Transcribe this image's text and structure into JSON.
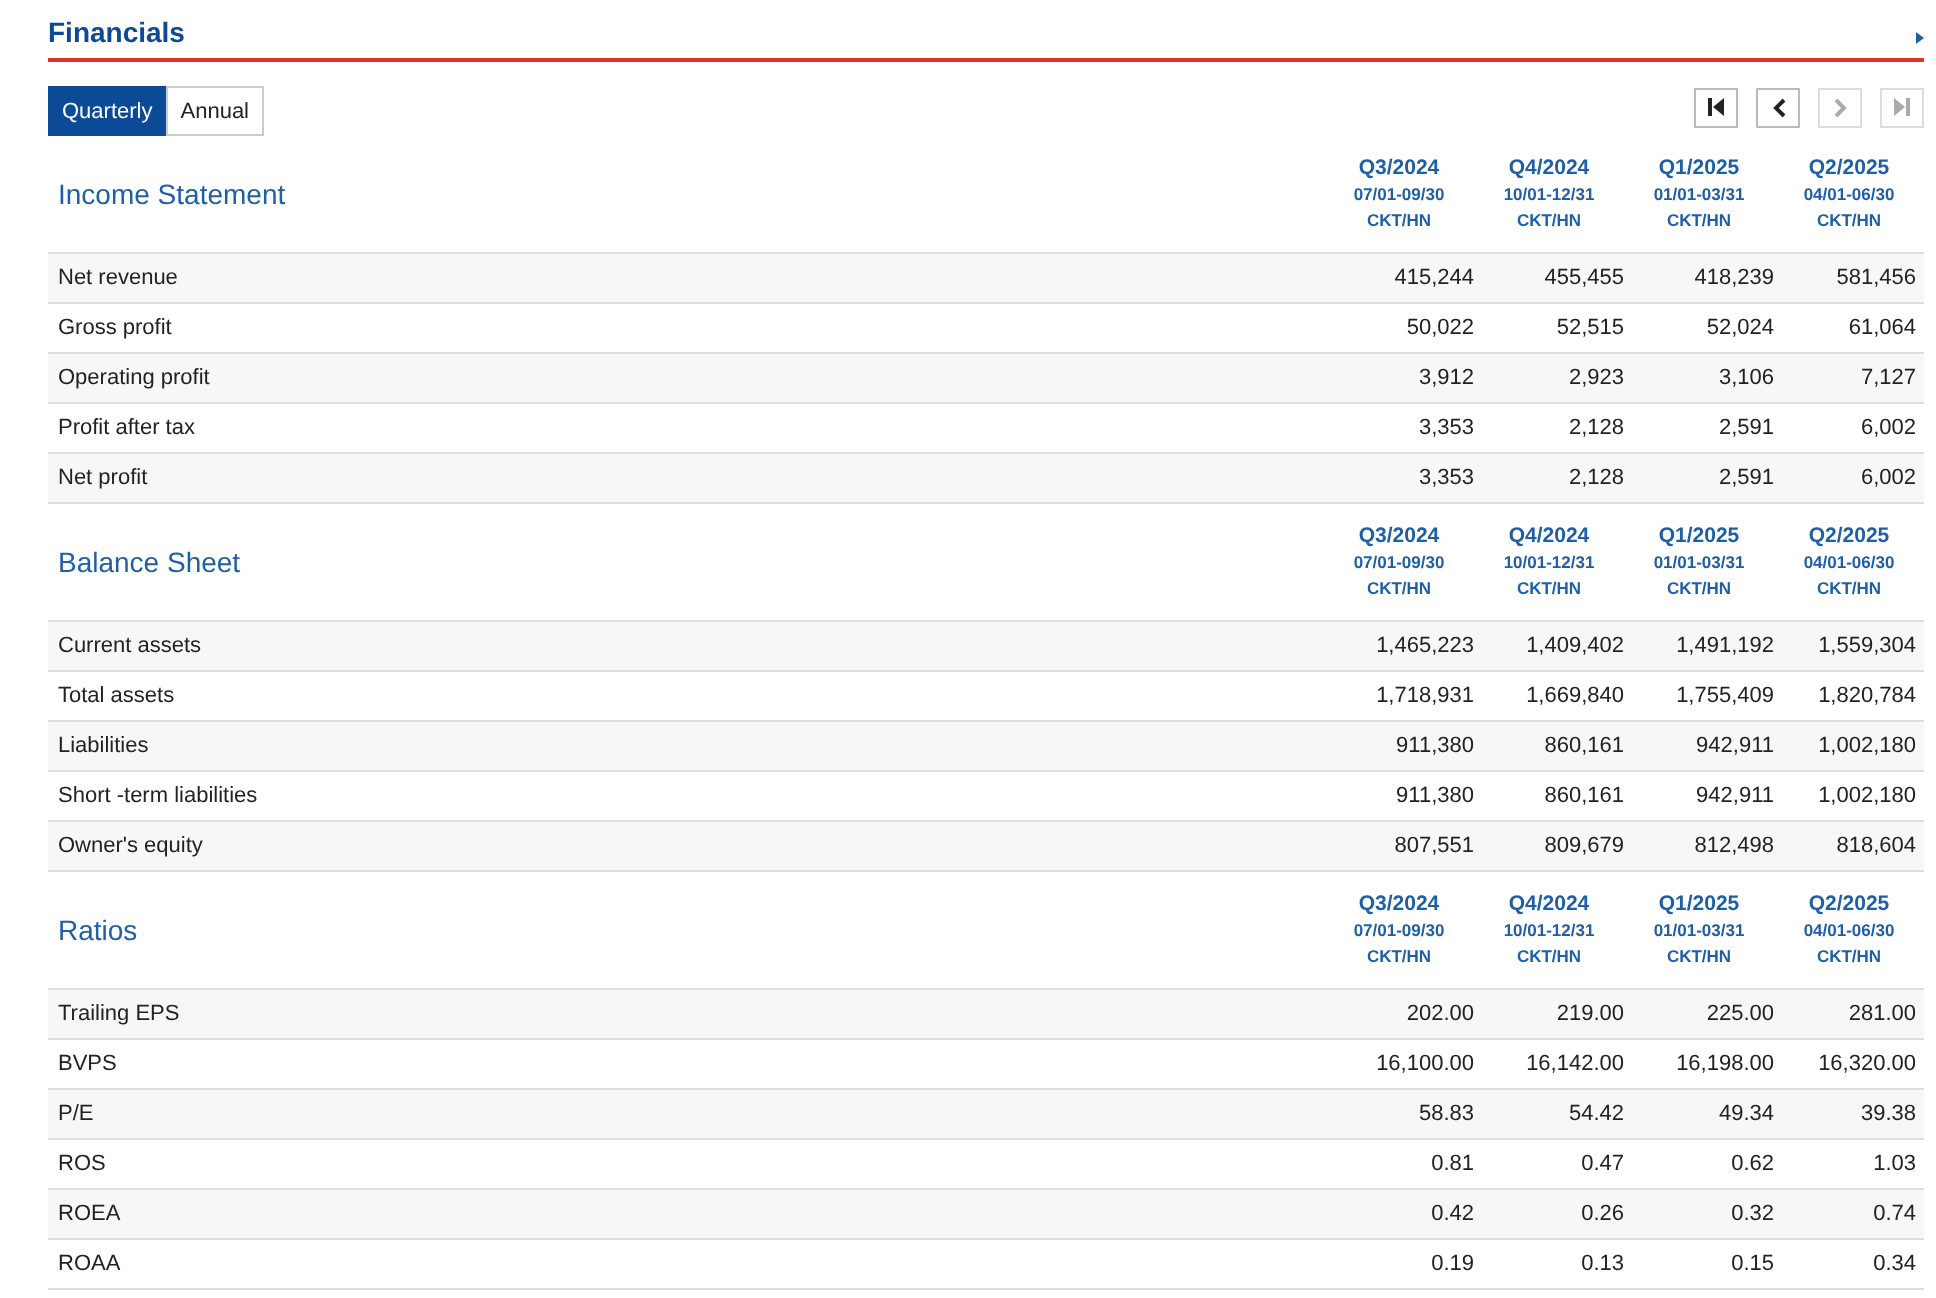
{
  "title": "Financials",
  "tabs": [
    {
      "label": "Quarterly",
      "selected": true
    },
    {
      "label": "Annual",
      "selected": false
    }
  ],
  "pager": [
    {
      "kind": "first",
      "disabled": false
    },
    {
      "kind": "prev",
      "disabled": false
    },
    {
      "kind": "next",
      "disabled": true
    },
    {
      "kind": "last",
      "disabled": true
    }
  ],
  "sections": [
    {
      "title": "Income Statement",
      "columns": [
        {
          "period": "Q3/2024",
          "range": "07/01-09/30",
          "audit": "CKT/HN"
        },
        {
          "period": "Q4/2024",
          "range": "10/01-12/31",
          "audit": "CKT/HN"
        },
        {
          "period": "Q1/2025",
          "range": "01/01-03/31",
          "audit": "CKT/HN"
        },
        {
          "period": "Q2/2025",
          "range": "04/01-06/30",
          "audit": "CKT/HN"
        }
      ],
      "rows": [
        {
          "label": "Net revenue",
          "values": [
            "415,244",
            "455,455",
            "418,239",
            "581,456"
          ]
        },
        {
          "label": "Gross profit",
          "values": [
            "50,022",
            "52,515",
            "52,024",
            "61,064"
          ]
        },
        {
          "label": "Operating profit",
          "values": [
            "3,912",
            "2,923",
            "3,106",
            "7,127"
          ]
        },
        {
          "label": "Profit after tax",
          "values": [
            "3,353",
            "2,128",
            "2,591",
            "6,002"
          ]
        },
        {
          "label": "Net profit",
          "values": [
            "3,353",
            "2,128",
            "2,591",
            "6,002"
          ]
        }
      ]
    },
    {
      "title": "Balance Sheet",
      "columns": [
        {
          "period": "Q3/2024",
          "range": "07/01-09/30",
          "audit": "CKT/HN"
        },
        {
          "period": "Q4/2024",
          "range": "10/01-12/31",
          "audit": "CKT/HN"
        },
        {
          "period": "Q1/2025",
          "range": "01/01-03/31",
          "audit": "CKT/HN"
        },
        {
          "period": "Q2/2025",
          "range": "04/01-06/30",
          "audit": "CKT/HN"
        }
      ],
      "rows": [
        {
          "label": "Current assets",
          "values": [
            "1,465,223",
            "1,409,402",
            "1,491,192",
            "1,559,304"
          ]
        },
        {
          "label": "Total assets",
          "values": [
            "1,718,931",
            "1,669,840",
            "1,755,409",
            "1,820,784"
          ]
        },
        {
          "label": "Liabilities",
          "values": [
            "911,380",
            "860,161",
            "942,911",
            "1,002,180"
          ]
        },
        {
          "label": "Short -term liabilities",
          "values": [
            "911,380",
            "860,161",
            "942,911",
            "1,002,180"
          ]
        },
        {
          "label": "Owner's equity",
          "values": [
            "807,551",
            "809,679",
            "812,498",
            "818,604"
          ]
        }
      ]
    },
    {
      "title": "Ratios",
      "columns": [
        {
          "period": "Q3/2024",
          "range": "07/01-09/30",
          "audit": "CKT/HN"
        },
        {
          "period": "Q4/2024",
          "range": "10/01-12/31",
          "audit": "CKT/HN"
        },
        {
          "period": "Q1/2025",
          "range": "01/01-03/31",
          "audit": "CKT/HN"
        },
        {
          "period": "Q2/2025",
          "range": "04/01-06/30",
          "audit": "CKT/HN"
        }
      ],
      "rows": [
        {
          "label": "Trailing EPS",
          "values": [
            "202.00",
            "219.00",
            "225.00",
            "281.00"
          ]
        },
        {
          "label": "BVPS",
          "values": [
            "16,100.00",
            "16,142.00",
            "16,198.00",
            "16,320.00"
          ]
        },
        {
          "label": "P/E",
          "values": [
            "58.83",
            "54.42",
            "49.34",
            "39.38"
          ]
        },
        {
          "label": "ROS",
          "values": [
            "0.81",
            "0.47",
            "0.62",
            "1.03"
          ]
        },
        {
          "label": "ROEA",
          "values": [
            "0.42",
            "0.26",
            "0.32",
            "0.74"
          ]
        },
        {
          "label": "ROAA",
          "values": [
            "0.19",
            "0.13",
            "0.15",
            "0.34"
          ]
        }
      ]
    }
  ]
}
